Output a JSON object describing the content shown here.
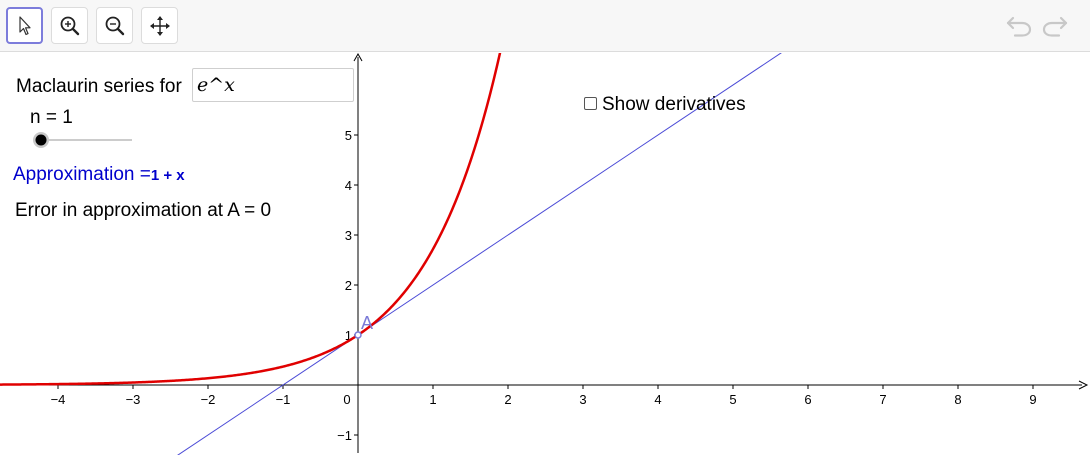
{
  "toolbar": {
    "tools": [
      {
        "name": "move-tool",
        "icon": "pointer-arrow-icon",
        "selected": true
      },
      {
        "name": "zoom-in-tool",
        "icon": "zoom-in-icon",
        "selected": false
      },
      {
        "name": "zoom-out-tool",
        "icon": "zoom-out-icon",
        "selected": false
      },
      {
        "name": "move-graphics-view-tool",
        "icon": "move-arrows-icon",
        "selected": false
      }
    ],
    "undo_icon": "undo-icon",
    "redo_icon": "redo-icon"
  },
  "panel": {
    "series_label": "Maclaurin series for",
    "function_input": "e^x",
    "n_label": "n = 1",
    "n_value": 1,
    "approx_label": "Approximation =",
    "approx_value": "1 + x",
    "error_label": "Error in approximation at A = 0",
    "show_derivatives_label": "Show derivatives",
    "show_derivatives_checked": false,
    "point_label": "A"
  },
  "colors": {
    "function_curve": "#e00000",
    "approx_line": "#4a4ad6",
    "approx_text": "#0000cc",
    "point": "#7b7bd8",
    "axes": "#000000"
  },
  "chart_data": {
    "type": "line",
    "x_ticks": [
      "−4",
      "−3",
      "−2",
      "−1",
      "0",
      "1",
      "2",
      "3",
      "4",
      "5",
      "6",
      "7",
      "8",
      "9"
    ],
    "y_ticks": [
      "−1",
      "1",
      "2",
      "3",
      "4",
      "5"
    ],
    "xlim": [
      -4.75,
      9.75
    ],
    "ylim": [
      -1.35,
      6.6
    ],
    "series": [
      {
        "function": "e^x",
        "color": "#e00000"
      },
      {
        "function": "1 + x",
        "color": "#4a4ad6"
      }
    ],
    "point": {
      "name": "A",
      "x": 0,
      "y": 1
    }
  }
}
